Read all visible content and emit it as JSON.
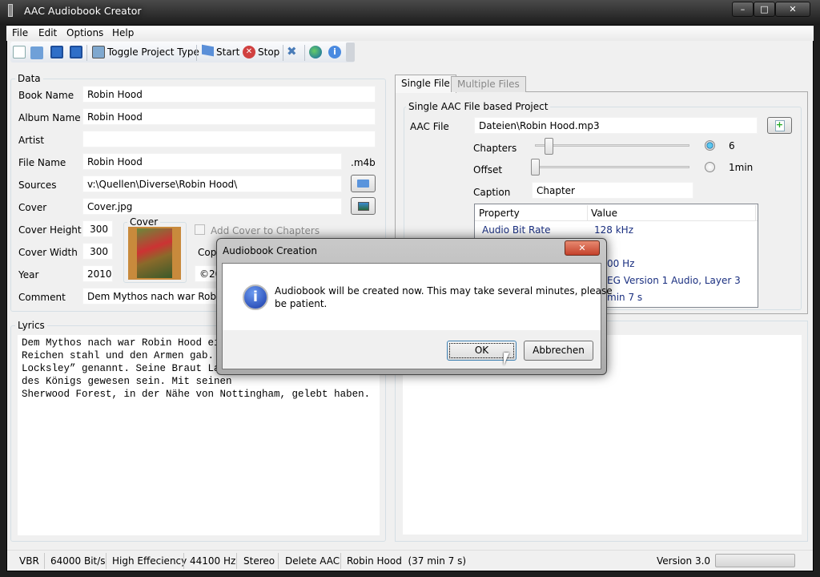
{
  "window": {
    "title": "AAC Audiobook Creator",
    "controls": [
      "minimize",
      "maximize",
      "close"
    ]
  },
  "menu": [
    "File",
    "Edit",
    "Options",
    "Help"
  ],
  "toolbar": {
    "icons": [
      "new-file-icon",
      "open-folder-icon",
      "save-icon",
      "save-as-icon"
    ],
    "toggle_label": "Toggle Project Type",
    "start_label": "Start",
    "stop_label": "Stop",
    "extra_icons": [
      "tools-icon",
      "globe-icon",
      "info-icon"
    ]
  },
  "data_group": {
    "title": "Data",
    "book_name_label": "Book Name",
    "book_name": "Robin Hood",
    "album_name_label": "Album Name",
    "album_name": "Robin Hood",
    "artist_label": "Artist",
    "artist": "",
    "file_name_label": "File Name",
    "file_name": "Robin Hood",
    "extension": ".m4b",
    "sources_label": "Sources",
    "sources": "v:\\Quellen\\Diverse\\Robin Hood\\",
    "cover_label": "Cover",
    "cover": "Cover.jpg",
    "cover_height_label": "Cover Height",
    "cover_height": "300",
    "cover_width_label": "Cover Width",
    "cover_width": "300",
    "year_label": "Year",
    "year": "2010",
    "cover_preview_title": "Cover",
    "add_cover_label": "Add Cover to Chapters",
    "add_cover_checked": false,
    "copyright_label_partial": "Cop",
    "copyright_partial": "©20",
    "comment_label": "Comment",
    "comment": "Dem Mythos nach war Robin H"
  },
  "lyrics": {
    "title": "Lyrics",
    "lines": [
      "Dem Mythos nach war Robin Hood ein",
      "Reichen stahl und den Armen gab. E",
      "Locksley” genannt. Seine Braut Lac",
      "des Königs gewesen sein. Mit seinen",
      "Sherwood Forest, in der Nähe von Nottingham, gelebt haben."
    ]
  },
  "tabs": [
    {
      "label": "Single File",
      "active": true
    },
    {
      "label": "Multiple Files",
      "active": false
    }
  ],
  "single": {
    "group_title": "Single AAC File based Project",
    "aac_label": "AAC File",
    "aac_file": "Dateien\\Robin Hood.mp3",
    "chapters_label": "Chapters",
    "chapters_value": "6",
    "chapters_selected": true,
    "offset_label": "Offset",
    "offset_value": "1min",
    "offset_selected": false,
    "caption_label": "Caption",
    "caption": "Chapter",
    "table": {
      "headers": [
        "Property",
        "Value"
      ],
      "rows": [
        [
          "Audio Bit Rate",
          "128 kHz"
        ]
      ],
      "partial_values": [
        "00 Hz",
        "EG Version 1 Audio, Layer 3",
        "min 7 s"
      ]
    }
  },
  "status": {
    "items": [
      "VBR",
      "64000 Bit/s",
      "High Effeciency",
      "44100 Hz",
      "Stereo",
      "Delete AAC",
      "Robin Hood  (37 min 7 s)"
    ],
    "version": "Version 3.0",
    "progress": 0
  },
  "dialog": {
    "title": "Audiobook Creation",
    "message_line1": "Audiobook will be created now. This may take several minutes, please",
    "message_line2": "be patient.",
    "ok": "OK",
    "cancel": "Abbrechen",
    "icon": "info-icon"
  },
  "colors": {
    "accent": "#1a2f80",
    "title_bar": "#2a2a2a",
    "close_button": "#c4412b"
  }
}
